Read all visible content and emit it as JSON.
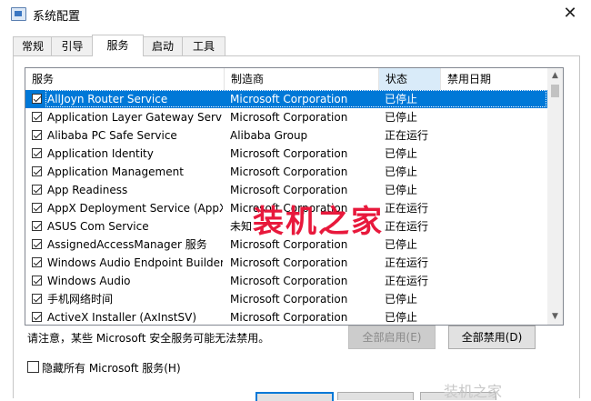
{
  "window": {
    "title": "系统配置",
    "close_glyph": "✕"
  },
  "tabs": [
    {
      "label": "常规",
      "active": false
    },
    {
      "label": "引导",
      "active": false
    },
    {
      "label": "服务",
      "active": true
    },
    {
      "label": "启动",
      "active": false
    },
    {
      "label": "工具",
      "active": false
    }
  ],
  "list": {
    "columns": [
      "服务",
      "制造商",
      "状态",
      "禁用日期"
    ],
    "sorted_column": "状态",
    "rows": [
      {
        "name": "AllJoyn Router Service",
        "manufacturer": "Microsoft Corporation",
        "status": "已停止",
        "checked": true,
        "selected": true
      },
      {
        "name": "Application Layer Gateway Service",
        "manufacturer": "Microsoft Corporation",
        "status": "已停止",
        "checked": true
      },
      {
        "name": "Alibaba PC Safe Service",
        "manufacturer": "Alibaba Group",
        "status": "正在运行",
        "checked": true
      },
      {
        "name": "Application Identity",
        "manufacturer": "Microsoft Corporation",
        "status": "已停止",
        "checked": true
      },
      {
        "name": "Application Management",
        "manufacturer": "Microsoft Corporation",
        "status": "已停止",
        "checked": true
      },
      {
        "name": "App Readiness",
        "manufacturer": "Microsoft Corporation",
        "status": "已停止",
        "checked": true
      },
      {
        "name": "AppX Deployment Service (AppX...",
        "manufacturer": "Microsoft Corporation",
        "status": "正在运行",
        "checked": true
      },
      {
        "name": "ASUS Com Service",
        "manufacturer": "未知",
        "status": "正在运行",
        "checked": true
      },
      {
        "name": "AssignedAccessManager 服务",
        "manufacturer": "Microsoft Corporation",
        "status": "已停止",
        "checked": true
      },
      {
        "name": "Windows Audio Endpoint Builder",
        "manufacturer": "Microsoft Corporation",
        "status": "正在运行",
        "checked": true
      },
      {
        "name": "Windows Audio",
        "manufacturer": "Microsoft Corporation",
        "status": "正在运行",
        "checked": true
      },
      {
        "name": "手机网络时间",
        "manufacturer": "Microsoft Corporation",
        "status": "已停止",
        "checked": true
      },
      {
        "name": "ActiveX Installer (AxInstSV)",
        "manufacturer": "Microsoft Corporation",
        "status": "已停止",
        "checked": true
      }
    ]
  },
  "note": "请注意，某些 Microsoft 安全服务可能无法禁用。",
  "buttons": {
    "enable_all": "全部启用(E)",
    "disable_all": "全部禁用(D)"
  },
  "hide_ms_services": {
    "label": "隐藏所有 Microsoft 服务(H)",
    "checked": false
  },
  "watermark": "装机之家",
  "corner_mark": "装机之家",
  "colors": {
    "selection": "#0078d7",
    "watermark": "#e8193c",
    "sorted_header": "#d9ebf9"
  }
}
